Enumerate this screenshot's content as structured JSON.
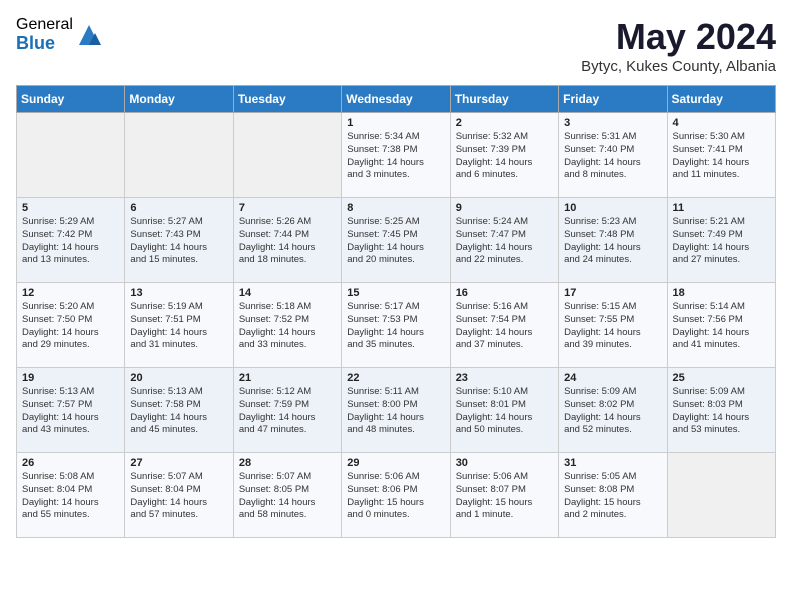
{
  "header": {
    "logo_general": "General",
    "logo_blue": "Blue",
    "month_year": "May 2024",
    "location": "Bytyc, Kukes County, Albania"
  },
  "days_of_week": [
    "Sunday",
    "Monday",
    "Tuesday",
    "Wednesday",
    "Thursday",
    "Friday",
    "Saturday"
  ],
  "weeks": [
    [
      {
        "day": "",
        "content": ""
      },
      {
        "day": "",
        "content": ""
      },
      {
        "day": "",
        "content": ""
      },
      {
        "day": "1",
        "content": "Sunrise: 5:34 AM\nSunset: 7:38 PM\nDaylight: 14 hours\nand 3 minutes."
      },
      {
        "day": "2",
        "content": "Sunrise: 5:32 AM\nSunset: 7:39 PM\nDaylight: 14 hours\nand 6 minutes."
      },
      {
        "day": "3",
        "content": "Sunrise: 5:31 AM\nSunset: 7:40 PM\nDaylight: 14 hours\nand 8 minutes."
      },
      {
        "day": "4",
        "content": "Sunrise: 5:30 AM\nSunset: 7:41 PM\nDaylight: 14 hours\nand 11 minutes."
      }
    ],
    [
      {
        "day": "5",
        "content": "Sunrise: 5:29 AM\nSunset: 7:42 PM\nDaylight: 14 hours\nand 13 minutes."
      },
      {
        "day": "6",
        "content": "Sunrise: 5:27 AM\nSunset: 7:43 PM\nDaylight: 14 hours\nand 15 minutes."
      },
      {
        "day": "7",
        "content": "Sunrise: 5:26 AM\nSunset: 7:44 PM\nDaylight: 14 hours\nand 18 minutes."
      },
      {
        "day": "8",
        "content": "Sunrise: 5:25 AM\nSunset: 7:45 PM\nDaylight: 14 hours\nand 20 minutes."
      },
      {
        "day": "9",
        "content": "Sunrise: 5:24 AM\nSunset: 7:47 PM\nDaylight: 14 hours\nand 22 minutes."
      },
      {
        "day": "10",
        "content": "Sunrise: 5:23 AM\nSunset: 7:48 PM\nDaylight: 14 hours\nand 24 minutes."
      },
      {
        "day": "11",
        "content": "Sunrise: 5:21 AM\nSunset: 7:49 PM\nDaylight: 14 hours\nand 27 minutes."
      }
    ],
    [
      {
        "day": "12",
        "content": "Sunrise: 5:20 AM\nSunset: 7:50 PM\nDaylight: 14 hours\nand 29 minutes."
      },
      {
        "day": "13",
        "content": "Sunrise: 5:19 AM\nSunset: 7:51 PM\nDaylight: 14 hours\nand 31 minutes."
      },
      {
        "day": "14",
        "content": "Sunrise: 5:18 AM\nSunset: 7:52 PM\nDaylight: 14 hours\nand 33 minutes."
      },
      {
        "day": "15",
        "content": "Sunrise: 5:17 AM\nSunset: 7:53 PM\nDaylight: 14 hours\nand 35 minutes."
      },
      {
        "day": "16",
        "content": "Sunrise: 5:16 AM\nSunset: 7:54 PM\nDaylight: 14 hours\nand 37 minutes."
      },
      {
        "day": "17",
        "content": "Sunrise: 5:15 AM\nSunset: 7:55 PM\nDaylight: 14 hours\nand 39 minutes."
      },
      {
        "day": "18",
        "content": "Sunrise: 5:14 AM\nSunset: 7:56 PM\nDaylight: 14 hours\nand 41 minutes."
      }
    ],
    [
      {
        "day": "19",
        "content": "Sunrise: 5:13 AM\nSunset: 7:57 PM\nDaylight: 14 hours\nand 43 minutes."
      },
      {
        "day": "20",
        "content": "Sunrise: 5:13 AM\nSunset: 7:58 PM\nDaylight: 14 hours\nand 45 minutes."
      },
      {
        "day": "21",
        "content": "Sunrise: 5:12 AM\nSunset: 7:59 PM\nDaylight: 14 hours\nand 47 minutes."
      },
      {
        "day": "22",
        "content": "Sunrise: 5:11 AM\nSunset: 8:00 PM\nDaylight: 14 hours\nand 48 minutes."
      },
      {
        "day": "23",
        "content": "Sunrise: 5:10 AM\nSunset: 8:01 PM\nDaylight: 14 hours\nand 50 minutes."
      },
      {
        "day": "24",
        "content": "Sunrise: 5:09 AM\nSunset: 8:02 PM\nDaylight: 14 hours\nand 52 minutes."
      },
      {
        "day": "25",
        "content": "Sunrise: 5:09 AM\nSunset: 8:03 PM\nDaylight: 14 hours\nand 53 minutes."
      }
    ],
    [
      {
        "day": "26",
        "content": "Sunrise: 5:08 AM\nSunset: 8:04 PM\nDaylight: 14 hours\nand 55 minutes."
      },
      {
        "day": "27",
        "content": "Sunrise: 5:07 AM\nSunset: 8:04 PM\nDaylight: 14 hours\nand 57 minutes."
      },
      {
        "day": "28",
        "content": "Sunrise: 5:07 AM\nSunset: 8:05 PM\nDaylight: 14 hours\nand 58 minutes."
      },
      {
        "day": "29",
        "content": "Sunrise: 5:06 AM\nSunset: 8:06 PM\nDaylight: 15 hours\nand 0 minutes."
      },
      {
        "day": "30",
        "content": "Sunrise: 5:06 AM\nSunset: 8:07 PM\nDaylight: 15 hours\nand 1 minute."
      },
      {
        "day": "31",
        "content": "Sunrise: 5:05 AM\nSunset: 8:08 PM\nDaylight: 15 hours\nand 2 minutes."
      },
      {
        "day": "",
        "content": ""
      }
    ]
  ]
}
